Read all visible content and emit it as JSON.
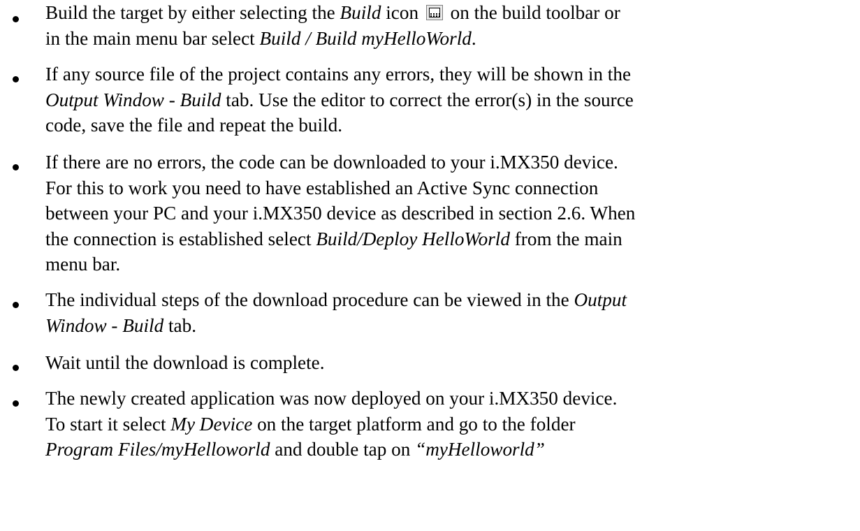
{
  "bullets": [
    {
      "id": "build",
      "lines": [
        [
          {
            "t": " Build the target by either selecting the "
          },
          {
            "t": "Build",
            "i": true
          },
          {
            "t": " icon "
          },
          {
            "icon": "build-icon"
          },
          {
            "t": " on the build toolbar or"
          }
        ],
        [
          {
            "t": "in the main menu bar select "
          },
          {
            "t": "Build / Build myHelloWorld",
            "i": true
          },
          {
            "t": "."
          }
        ]
      ]
    },
    {
      "id": "errors",
      "lines": [
        [
          {
            "t": " If any source file of the project contains any errors, they will be shown in the"
          }
        ],
        [
          {
            "t": "Output Window",
            "i": true
          },
          {
            "t": " - "
          },
          {
            "t": "Build",
            "i": true
          },
          {
            "t": " tab. Use the editor to correct the error(s) in the source"
          }
        ],
        [
          {
            "t": "code, save the file and repeat the build."
          }
        ]
      ]
    },
    {
      "id": "download",
      "lines": [
        [
          {
            "t": " If there are no errors, the code can be downloaded to your i.MX350 device."
          }
        ],
        [
          {
            "t": "For this to work you need to have established an Active Sync connection"
          }
        ],
        [
          {
            "t": "between your PC and your i.MX350 device as described in section 2.6. When"
          }
        ],
        [
          {
            "t": "the connection is established select "
          },
          {
            "t": "Build/Deploy HelloWorld",
            "i": true
          },
          {
            "t": " from the main"
          }
        ],
        [
          {
            "t": "menu bar."
          }
        ]
      ]
    },
    {
      "id": "steps",
      "lines": [
        [
          {
            "t": " The individual steps of the download procedure can be viewed in the "
          },
          {
            "t": "Output",
            "i": true
          }
        ],
        [
          {
            "t": "Window",
            "i": true
          },
          {
            "t": " - "
          },
          {
            "t": "Build",
            "i": true
          },
          {
            "t": " tab."
          }
        ]
      ]
    },
    {
      "id": "wait",
      "lines": [
        [
          {
            "t": " Wait until the download is complete."
          }
        ]
      ]
    },
    {
      "id": "start",
      "lines": [
        [
          {
            "t": " The newly created application was now deployed on your i.MX350 device."
          }
        ],
        [
          {
            "t": "To start it select "
          },
          {
            "t": "My Device",
            "i": true
          },
          {
            "t": " on the target platform and go to the folder"
          }
        ],
        [
          {
            "t": "Program Files/myHelloworld",
            "i": true
          },
          {
            "t": " and double tap on "
          },
          {
            "t": "“myHelloworld”",
            "i": true
          }
        ]
      ]
    }
  ]
}
